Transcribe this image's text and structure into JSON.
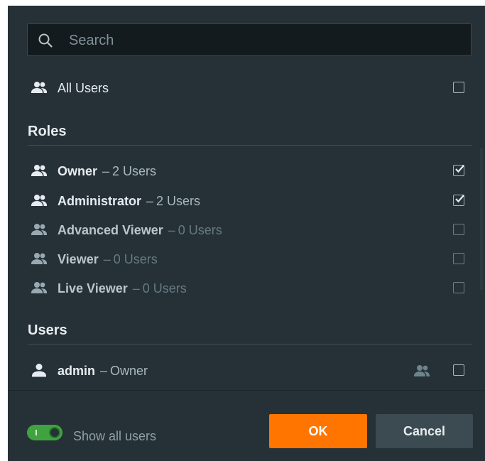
{
  "search": {
    "placeholder": "Search",
    "value": ""
  },
  "all_users": {
    "label": "All Users",
    "checked": false
  },
  "roles": {
    "title": "Roles",
    "items": [
      {
        "name": "Owner",
        "dash": "–",
        "count": "2 Users",
        "checked": true
      },
      {
        "name": "Administrator",
        "dash": "–",
        "count": "2 Users",
        "checked": true
      },
      {
        "name": "Advanced Viewer",
        "dash": "–",
        "count": "0 Users",
        "checked": false
      },
      {
        "name": "Viewer",
        "dash": "–",
        "count": "0 Users",
        "checked": false
      },
      {
        "name": "Live Viewer",
        "dash": "–",
        "count": "0 Users",
        "checked": false
      }
    ]
  },
  "users": {
    "title": "Users",
    "items": [
      {
        "name": "admin",
        "dash": "–",
        "role": "Owner",
        "checked": false
      }
    ]
  },
  "footer": {
    "toggle_label": "Show all users",
    "toggle_on": true,
    "ok_label": "OK",
    "cancel_label": "Cancel"
  },
  "colors": {
    "background": "#263137",
    "accent": "#ff7500",
    "toggle": "#3fa43f"
  },
  "icons": [
    "search-icon",
    "users-group-icon",
    "user-icon",
    "checkbox-checked-icon"
  ]
}
